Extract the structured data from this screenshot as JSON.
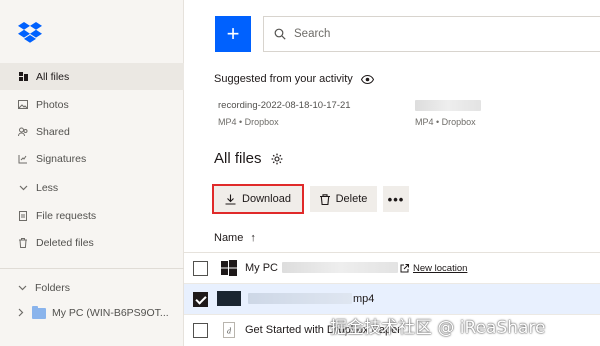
{
  "sidebar": {
    "items": [
      {
        "label": "All files",
        "icon": "files-icon",
        "active": true
      },
      {
        "label": "Photos",
        "icon": "photos-icon",
        "active": false
      },
      {
        "label": "Shared",
        "icon": "shared-icon",
        "active": false
      },
      {
        "label": "Signatures",
        "icon": "signature-icon",
        "active": false
      },
      {
        "label": "Less",
        "icon": "chevron-down-icon",
        "active": false
      },
      {
        "label": "File requests",
        "icon": "file-request-icon",
        "active": false
      },
      {
        "label": "Deleted files",
        "icon": "trash-icon",
        "active": false
      }
    ],
    "folders_label": "Folders",
    "folder_item": "My PC (WIN-B6PS9OT..."
  },
  "toolbar": {
    "plus_label": "+",
    "search_placeholder": "Search"
  },
  "suggested": {
    "title": "Suggested from your activity",
    "items": [
      {
        "name": "recording-2022-08-18-10-17-21",
        "meta": "MP4 • Dropbox"
      },
      {
        "name": "",
        "meta": "MP4 • Dropbox"
      }
    ]
  },
  "files": {
    "title": "All files",
    "download_label": "Download",
    "delete_label": "Delete",
    "more_label": "•••",
    "name_header": "Name",
    "sort_arrow": "↑",
    "rows": [
      {
        "name": "My PC",
        "extra": "New location",
        "checked": false,
        "icon": "windows-icon"
      },
      {
        "name": "mp4",
        "extra": "",
        "checked": true,
        "icon": "video-thumbnail-icon"
      },
      {
        "name": "Get Started with Dropbox Paper",
        "extra": "",
        "checked": false,
        "icon": "paper-icon"
      }
    ]
  },
  "watermark": "掘金技术社区 @ iReaShare",
  "colors": {
    "accent": "#0061fe",
    "highlight_border": "#e02a2a",
    "selected_row": "#e8f0fe",
    "sidebar_bg": "#f7f5f2"
  }
}
